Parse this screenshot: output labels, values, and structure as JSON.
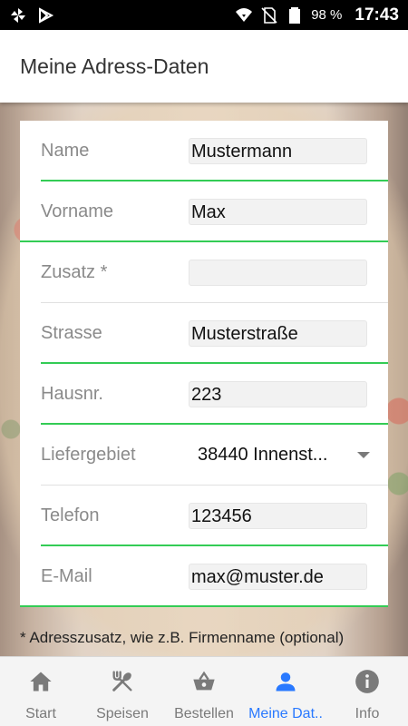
{
  "status_bar": {
    "battery": "98 %",
    "time": "17:43",
    "icons": [
      "pinwheel-icon",
      "play-icon",
      "wifi-icon",
      "no-sim-icon",
      "battery-icon"
    ]
  },
  "header": {
    "title": "Meine Adress-Daten"
  },
  "form": {
    "fields": [
      {
        "label": "Name",
        "value": "Mustermann"
      },
      {
        "label": "Vorname",
        "value": "Max"
      },
      {
        "label": "Zusatz *",
        "value": ""
      },
      {
        "label": "Strasse",
        "value": "Musterstraße"
      },
      {
        "label": "Hausnr.",
        "value": "223"
      },
      {
        "label": "Liefergebiet",
        "value": "38440 Innenst..."
      },
      {
        "label": "Telefon",
        "value": "123456"
      },
      {
        "label": "E-Mail",
        "value": "max@muster.de"
      }
    ]
  },
  "footnote": "* Adresszusatz, wie z.B. Firmenname (optional)",
  "bottom_nav": {
    "items": [
      {
        "label": "Start",
        "icon": "home-icon"
      },
      {
        "label": "Speisen",
        "icon": "utensils-icon"
      },
      {
        "label": "Bestellen",
        "icon": "basket-icon"
      },
      {
        "label": "Meine Dat..",
        "icon": "person-icon"
      },
      {
        "label": "Info",
        "icon": "info-icon"
      }
    ],
    "active_index": 3,
    "active_color": "#2979ff",
    "inactive_color": "#7a7a7a"
  },
  "colors": {
    "accent_underline": "#33cc55"
  }
}
